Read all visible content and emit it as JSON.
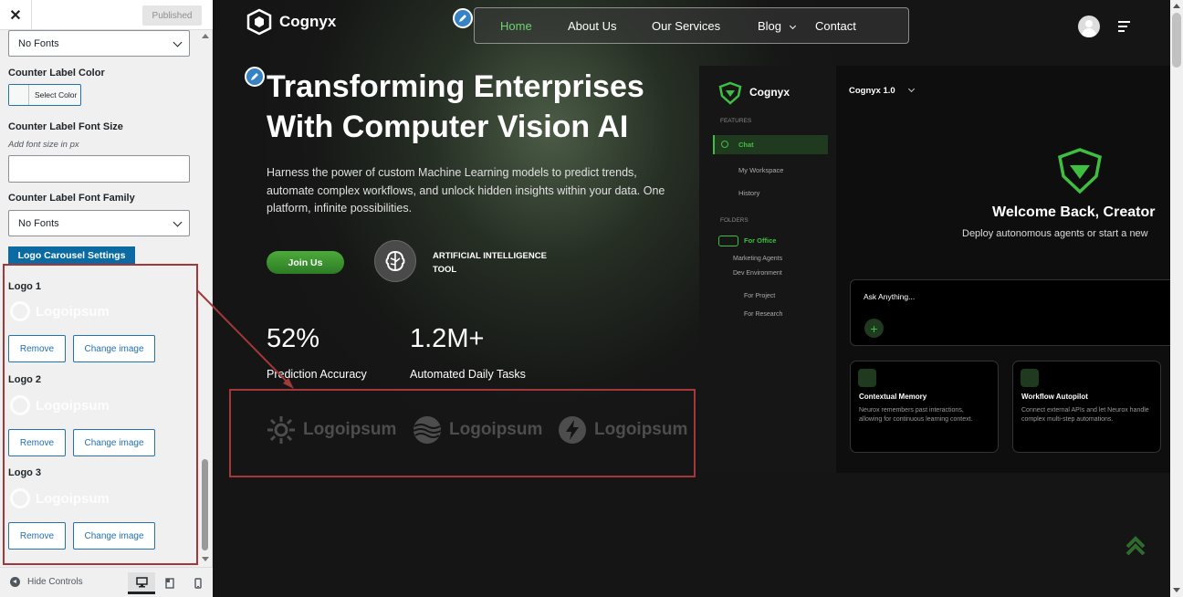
{
  "customizer": {
    "close_symbol": "✕",
    "published_label": "Published",
    "top_select_value": "No Fonts",
    "counter_label_color": "Counter Label Color",
    "select_color": "Select Color",
    "counter_label_font_size": "Counter Label Font Size",
    "font_size_hint": "Add font size in px",
    "font_size_value": "",
    "counter_label_font_family": "Counter Label Font Family",
    "font_family_value": "No Fonts",
    "logo_carousel_settings": "Logo Carousel Settings",
    "logos": [
      {
        "label": "Logo 1",
        "preview": "Logoipsum",
        "remove": "Remove",
        "change": "Change image"
      },
      {
        "label": "Logo 2",
        "preview": "Logoipsum",
        "remove": "Remove",
        "change": "Change image"
      },
      {
        "label": "Logo 3",
        "preview": "Logoipsum",
        "remove": "Remove",
        "change": "Change image"
      }
    ],
    "hide_controls": "Hide Controls"
  },
  "site": {
    "brand": "Cognyx",
    "nav": [
      "Home",
      "About Us",
      "Our Services",
      "Blog",
      "Contact"
    ],
    "hero_title_line1": "Transforming Enterprises",
    "hero_title_line2": "With Computer Vision AI",
    "hero_desc": "Harness the power of custom Machine Learning models to predict trends, automate complex workflows, and unlock hidden insights within your data. One platform, infinite possibilities.",
    "join_label": "Join Us",
    "ai_line1": "ARTIFICIAL INTELLIGENCE",
    "ai_line2": "TOOL",
    "stats": [
      {
        "value": "52%",
        "label": "Prediction Accuracy"
      },
      {
        "value": "1.2M+",
        "label": "Automated Daily Tasks"
      }
    ],
    "logo_strip": [
      "Logoipsum",
      "Logoipsum",
      "Logoipsum"
    ]
  },
  "mock": {
    "brand": "Cognyx",
    "version": "Cognyx 1.0",
    "features": "FEATURES",
    "chat": "Chat",
    "my_workspace": "My Workspace",
    "history": "History",
    "folders": "FOLDERS",
    "for_office": "For Office",
    "marketing_agents": "Marketing Agents",
    "dev_environment": "Dev Environment",
    "for_project": "For Project",
    "for_research": "For Research",
    "welcome": "Welcome Back, Creator",
    "deploy": "Deploy autonomous agents or start a new",
    "ask": "Ask Anything...",
    "card1_title": "Contextual Memory",
    "card1_desc": "Neurox remembers past interactions, allowing for continuous learning context.",
    "card2_title": "Workflow Autopilot",
    "card2_desc": "Connect external APIs and let Neurox handle complex multi-step automations."
  },
  "colors": {
    "accent_green": "#3fbf3f",
    "wp_blue": "#2271b1",
    "annotation_red": "#a3383b"
  }
}
